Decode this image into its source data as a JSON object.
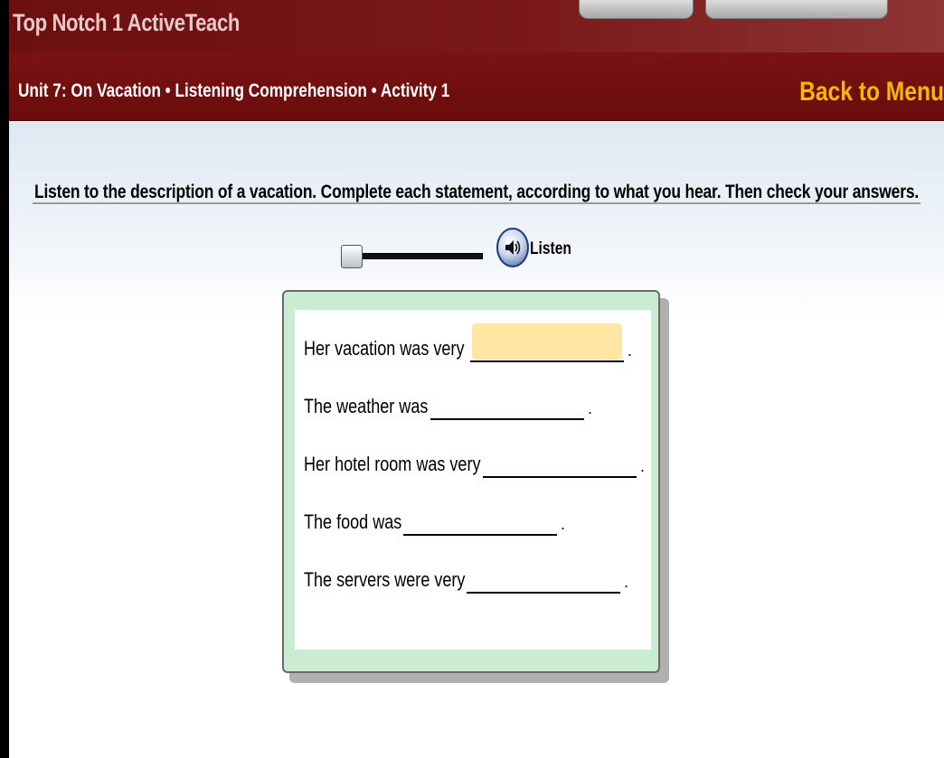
{
  "app": {
    "title": "Top Notch 1 ActiveTeach"
  },
  "nav": {
    "breadcrumb": "Unit 7: On Vacation • Listening Comprehension • Activity 1",
    "back_label": "Back to Menu"
  },
  "activity": {
    "instructions": "Listen to the description of a vacation. Complete each statement, according to what you hear. Then check your answers.",
    "listen_label": "Listen",
    "audio_progress": 0,
    "questions": [
      {
        "prompt": "Her vacation was very",
        "answer": "",
        "focused": true,
        "period": "."
      },
      {
        "prompt": "The weather was",
        "answer": "",
        "focused": false,
        "period": "."
      },
      {
        "prompt": "Her hotel room was very",
        "answer": "",
        "focused": false,
        "period": "."
      },
      {
        "prompt": "The food was",
        "answer": "",
        "focused": false,
        "period": "."
      },
      {
        "prompt": "The servers were very",
        "answer": "",
        "focused": false,
        "period": "."
      }
    ]
  },
  "colors": {
    "header_dark": "#6a0c0c",
    "back_link": "#f5b800",
    "card_bg": "#c9ecd3",
    "focused_input": "#ffe7a3"
  },
  "icons": {
    "listen": "speaker-icon"
  }
}
